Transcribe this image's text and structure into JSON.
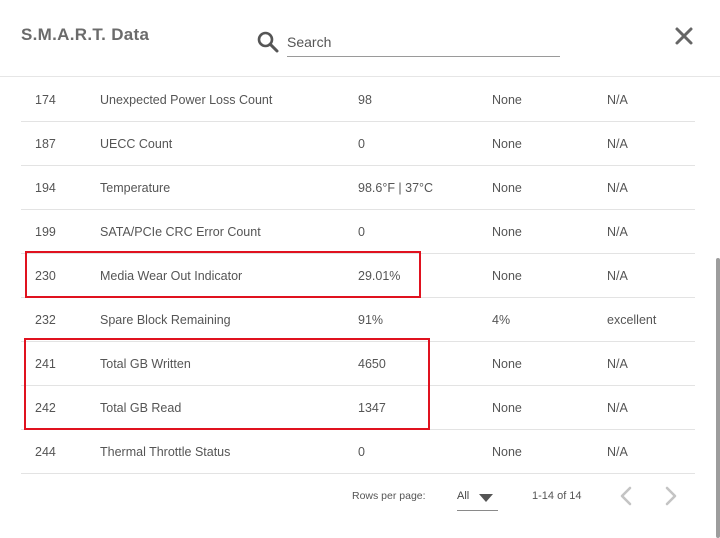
{
  "dialog": {
    "title": "S.M.A.R.T. Data"
  },
  "search": {
    "placeholder": "Search",
    "icon": "search-icon"
  },
  "close": {
    "icon": "close-icon"
  },
  "table": {
    "rows": [
      {
        "id": "174",
        "name": "Unexpected Power Loss Count",
        "value": "98",
        "threshold": "None",
        "status": "N/A"
      },
      {
        "id": "187",
        "name": "UECC Count",
        "value": "0",
        "threshold": "None",
        "status": "N/A"
      },
      {
        "id": "194",
        "name": "Temperature",
        "value": "98.6°F | 37°C",
        "threshold": "None",
        "status": "N/A"
      },
      {
        "id": "199",
        "name": "SATA/PCIe CRC Error Count",
        "value": "0",
        "threshold": "None",
        "status": "N/A"
      },
      {
        "id": "230",
        "name": "Media Wear Out Indicator",
        "value": "29.01%",
        "threshold": "None",
        "status": "N/A"
      },
      {
        "id": "232",
        "name": "Spare Block Remaining",
        "value": "91%",
        "threshold": "4%",
        "status": "excellent"
      },
      {
        "id": "241",
        "name": "Total GB Written",
        "value": "4650",
        "threshold": "None",
        "status": "N/A"
      },
      {
        "id": "242",
        "name": "Total GB Read",
        "value": "1347",
        "threshold": "None",
        "status": "N/A"
      },
      {
        "id": "244",
        "name": "Thermal Throttle Status",
        "value": "0",
        "threshold": "None",
        "status": "N/A"
      }
    ]
  },
  "pagination": {
    "rows_per_page_label": "Rows per page:",
    "rows_per_page_value": "All",
    "range": "1-14 of 14",
    "prev_icon": "chevron-left-icon",
    "next_icon": "chevron-right-icon"
  },
  "colors": {
    "highlight": "#e0121f",
    "divider": "#e3e3e3",
    "text": "#555555",
    "title": "#6b6b6b"
  }
}
